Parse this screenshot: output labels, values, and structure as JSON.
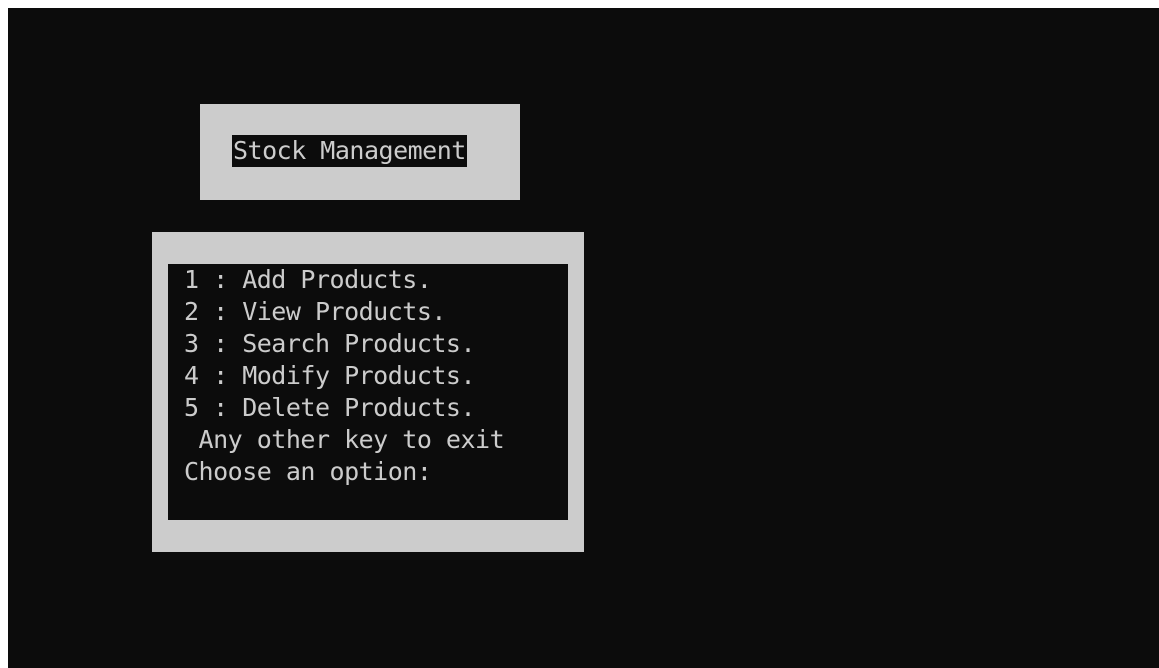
{
  "window": {
    "title": "Stock Management"
  },
  "menu": {
    "options": [
      "1 : Add Products.",
      "2 : View Products.",
      "3 : Search Products.",
      "4 : Modify Products.",
      "5 : Delete Products."
    ],
    "exit_hint": " Any other key to exit",
    "prompt": "Choose an option:"
  },
  "colors": {
    "console_background": "#0c0c0c",
    "frame": "#cccccc",
    "text": "#cccccc"
  }
}
